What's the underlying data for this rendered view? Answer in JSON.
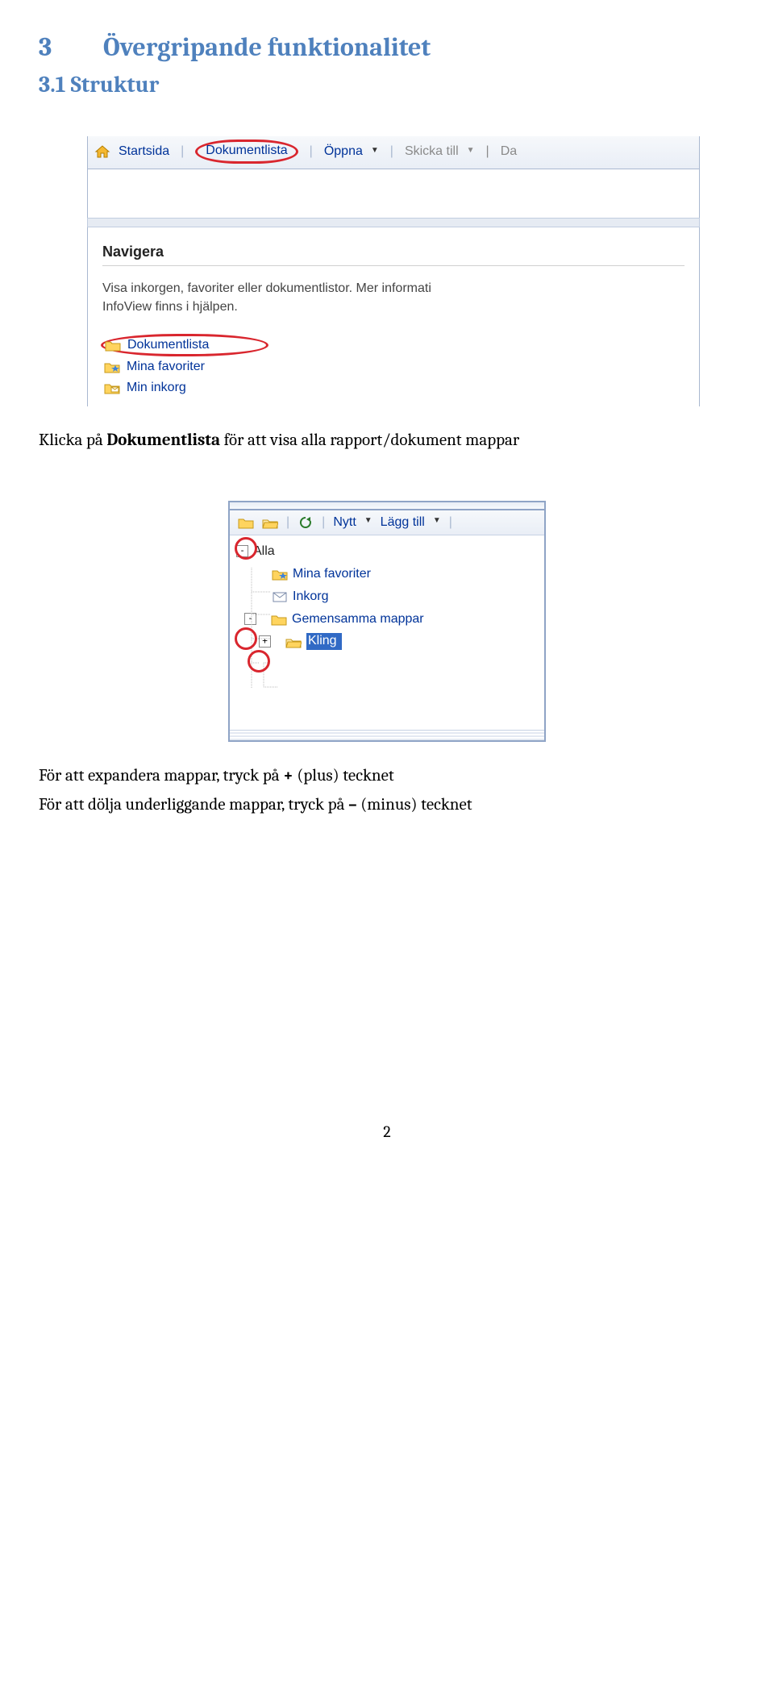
{
  "section": {
    "num": "3",
    "title": "Övergripande funktionalitet"
  },
  "subsection": {
    "num": "3.1",
    "title": "Struktur"
  },
  "screenshot1": {
    "toolbar": {
      "home": "Startsida",
      "doclist": "Dokumentlista",
      "open": "Öppna",
      "sendto": "Skicka till",
      "da": "Da"
    },
    "panel_title": "Navigera",
    "panel_text1": "Visa inkorgen, favoriter eller dokumentlistor. Mer informati",
    "panel_text2": "InfoView finns i hjälpen.",
    "nav": {
      "doclist": "Dokumentlista",
      "favs": "Mina favoriter",
      "inbox": "Min inkorg"
    }
  },
  "para1_pre": "Klicka på ",
  "para1_bold": "Dokumentlista",
  "para1_post": " för att visa alla rapport/dokument mappar",
  "screenshot2": {
    "toolbar": {
      "refresh": "",
      "new": "Nytt",
      "add": "Lägg till"
    },
    "tree": {
      "all": "Alla",
      "favs": "Mina favoriter",
      "inbox": "Inkorg",
      "shared": "Gemensamma mappar",
      "kling": "Kling"
    }
  },
  "para2_pre": "För att expandera mappar, tryck på ",
  "para2_bold": "+",
  "para2_post": " (plus) tecknet",
  "para3_pre": "För att dölja underliggande mappar, tryck på ",
  "para3_bold": "–",
  "para3_post": " (minus) tecknet",
  "page_number": "2"
}
